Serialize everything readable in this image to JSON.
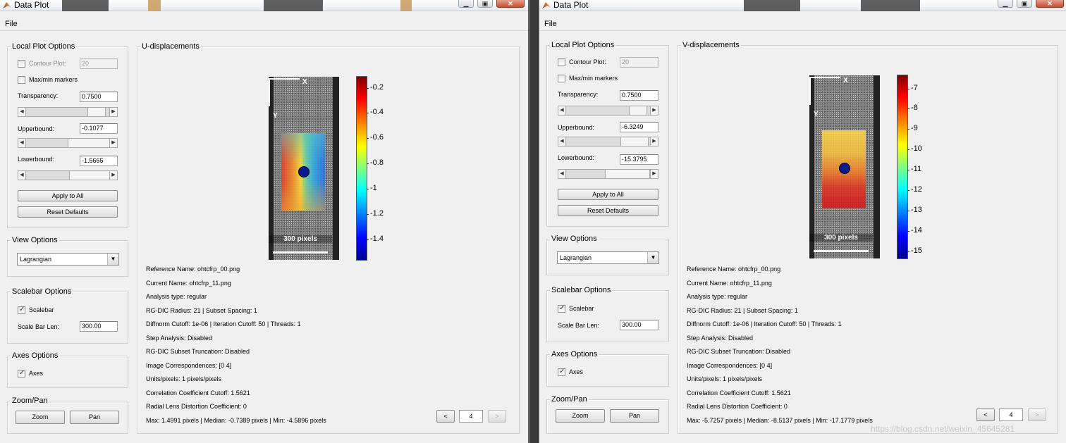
{
  "windows": [
    {
      "title": "Data Plot",
      "menu_file": "File",
      "local_plot_options": {
        "title": "Local Plot Options",
        "contour_plot_label": "Contour Plot:",
        "contour_value": "20",
        "contour_checked": false,
        "maxmin_label": "Max/min markers",
        "maxmin_checked": false,
        "transparency_label": "Transparency:",
        "transparency_value": "0.7500",
        "transparency_level": 0.75,
        "upperbound_label": "Upperbound:",
        "upperbound_value": "-0.1077",
        "upperbound_level": 0.55,
        "lowerbound_label": "Lowerbound:",
        "lowerbound_value": "-1.5665",
        "lowerbound_level": 0.48,
        "apply_all": "Apply to All",
        "reset_defaults": "Reset Defaults"
      },
      "view_options": {
        "title": "View Options",
        "selected": "Lagrangian"
      },
      "scalebar_options": {
        "title": "Scalebar Options",
        "scalebar_label": "Scalebar",
        "scalebar_checked": true,
        "len_label": "Scale Bar Len:",
        "len_value": "300.00"
      },
      "axes_options": {
        "title": "Axes Options",
        "axes_label": "Axes",
        "axes_checked": true
      },
      "zoom_pan": {
        "title": "Zoom/Pan",
        "zoom": "Zoom",
        "pan": "Pan"
      },
      "plot": {
        "title": "U-displacements",
        "axis_x": "X",
        "axis_y": "Y",
        "scalebar_text": "300 pixels",
        "colorbar_ticks": [
          "-0.2",
          "-0.4",
          "-0.6",
          "-0.8",
          "-1",
          "-1.2",
          "-1.4"
        ],
        "colorbar_range": [
          -1.5665,
          -0.1077
        ]
      },
      "info": [
        "Reference Name: ohtcfrp_00.png",
        "Current Name: ohtcfrp_11.png",
        "Analysis type: regular",
        "RG-DIC Radius: 21 | Subset Spacing: 1",
        "Diffnorm Cutoff: 1e-06 | Iteration Cutoff: 50 | Threads: 1",
        "Step Analysis: Disabled",
        "RG-DIC Subset Truncation: Disabled",
        "Image Correspondences: [0 4]",
        "Units/pixels: 1 pixels/pixels",
        "Correlation Coefficient Cutoff: 1.5621",
        "Radial Lens Distortion Coefficient: 0",
        "Max: 1.4991 pixels | Median: -0.7389 pixels | Min: -4.5896 pixels"
      ],
      "nav": {
        "prev": "<",
        "index": "4",
        "next": ">"
      }
    },
    {
      "title": "Data Plot",
      "menu_file": "File",
      "local_plot_options": {
        "title": "Local Plot Options",
        "contour_plot_label": "Contour Plot:",
        "contour_value": "20",
        "contour_checked": false,
        "maxmin_label": "Max/min markers",
        "maxmin_checked": false,
        "transparency_label": "Transparency:",
        "transparency_value": "0.7500",
        "transparency_level": 0.75,
        "upperbound_label": "Upperbound:",
        "upperbound_value": "-6.3249",
        "upperbound_level": 0.62,
        "lowerbound_label": "Lowerbound:",
        "lowerbound_value": "-15.3795",
        "lowerbound_level": 0.42,
        "apply_all": "Apply to All",
        "reset_defaults": "Reset Defaults"
      },
      "view_options": {
        "title": "View Options",
        "selected": "Lagrangian"
      },
      "scalebar_options": {
        "title": "Scalebar Options",
        "scalebar_label": "Scalebar",
        "scalebar_checked": true,
        "len_label": "Scale Bar Len:",
        "len_value": "300.00"
      },
      "axes_options": {
        "title": "Axes Options",
        "axes_label": "Axes",
        "axes_checked": true
      },
      "zoom_pan": {
        "title": "Zoom/Pan",
        "zoom": "Zoom",
        "pan": "Pan"
      },
      "plot": {
        "title": "V-displacements",
        "axis_x": "X",
        "axis_y": "Y",
        "scalebar_text": "300 pixels",
        "colorbar_ticks": [
          "-7",
          "-8",
          "-9",
          "-10",
          "-11",
          "-12",
          "-13",
          "-14",
          "-15"
        ],
        "colorbar_range": [
          -15.3795,
          -6.3249
        ]
      },
      "info": [
        "Reference Name: ohtcfrp_00.png",
        "Current Name: ohtcfrp_11.png",
        "Analysis type: regular",
        "RG-DIC Radius: 21 | Subset Spacing: 1",
        "Diffnorm Cutoff: 1e-06 | Iteration Cutoff: 50 | Threads: 1",
        "Step Analysis: Disabled",
        "RG-DIC Subset Truncation: Disabled",
        "Image Correspondences: [0 4]",
        "Units/pixels: 1 pixels/pixels",
        "Correlation Coefficient Cutoff: 1.5621",
        "Radial Lens Distortion Coefficient: 0",
        "Max: -5.7257 pixels | Median: -8.5137 pixels | Min: -17.1779 pixels"
      ],
      "nav": {
        "prev": "<",
        "index": "4",
        "next": ">"
      }
    }
  ],
  "watermark": "https://blog.csdn.net/weixin_45645281",
  "colors": {
    "window_bg": "#f0f0f0",
    "jet_top": "#8b0000",
    "jet_bottom": "#00008b"
  }
}
